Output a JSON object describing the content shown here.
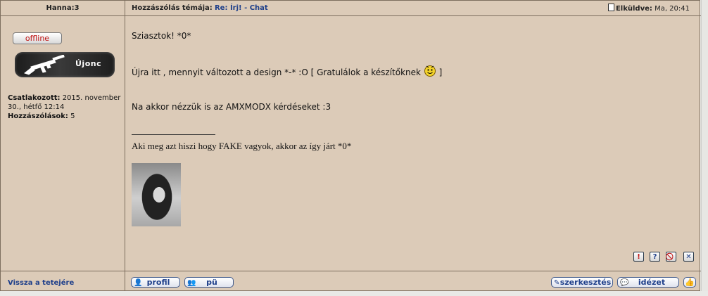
{
  "header": {
    "username": "Hanna:3",
    "topic_label": "Hozzászólás témája:",
    "topic_link": "Re: Írj! - Chat",
    "posted_label": "Elküldve:",
    "posted_time": "Ma, 20:41"
  },
  "author": {
    "status_label": "offline",
    "rank_label": "Újonc",
    "joined_label": "Csatlakozott:",
    "joined_value": "2015. november 30., hétfő 12:14",
    "posts_label": "Hozzászólások:",
    "posts_value": "5"
  },
  "message": {
    "line1": "Sziasztok! *0*",
    "line2": "Újra itt , mennyit változott a design *-* :O [ Gratulálok a készítőknek",
    "line2_end": "]",
    "line3": "Na akkor nézzük is az AMXMODX kérdéseket :3",
    "signature": "Aki meg azt hiszi hogy FAKE vagyok, akkor az így járt *0*"
  },
  "post_actions": {
    "report": "!",
    "help": "?",
    "warn": "⃠",
    "delete": "✕"
  },
  "footer": {
    "back_to_top": "Vissza a tetejére",
    "profile_button": "profil",
    "pm_button": "pü",
    "edit_button": "szerkesztés",
    "quote_button": "idézet",
    "thanks_button": "👍"
  },
  "colors": {
    "background": "#dccbb8",
    "border": "#7d6e5e",
    "link": "#1e3f8a",
    "offline": "#c01010"
  }
}
